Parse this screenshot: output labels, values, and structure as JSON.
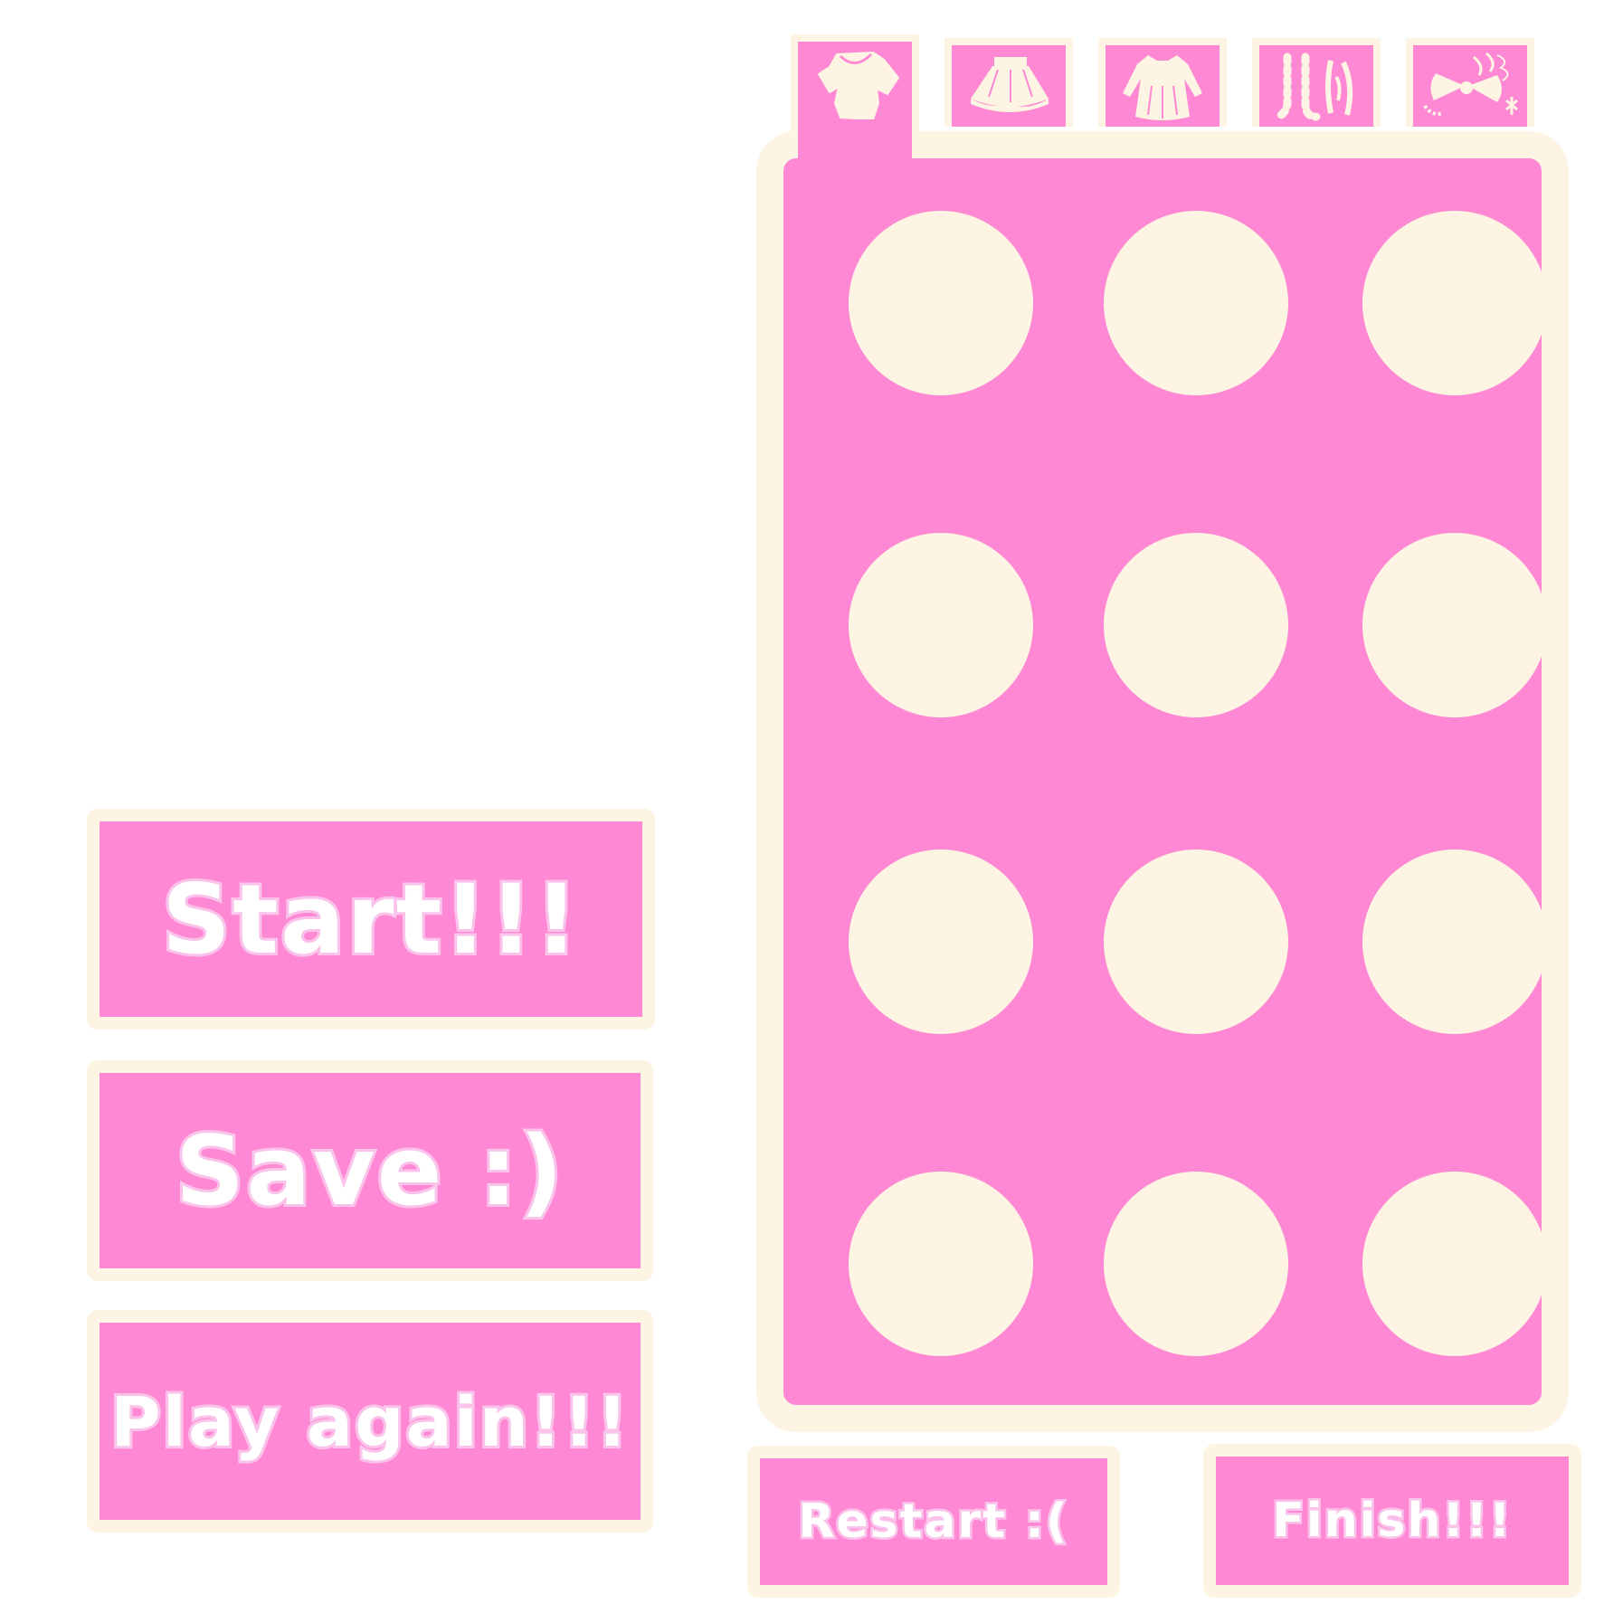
{
  "menu": {
    "start_label": "Start!!!",
    "save_label": "Save :)",
    "play_again_label": "Play again!!!"
  },
  "wardrobe": {
    "tabs": [
      {
        "icon": "shirt-icon",
        "active": true
      },
      {
        "icon": "skirt-icon",
        "active": false
      },
      {
        "icon": "dress-icon",
        "active": false
      },
      {
        "icon": "socks-icon",
        "active": false
      },
      {
        "icon": "accessories-icon",
        "active": false
      }
    ],
    "slot_rows": 4,
    "slot_columns": 3
  },
  "actions": {
    "restart_label": "Restart :(",
    "finish_label": "Finish!!!"
  },
  "colors": {
    "primary_pink": "#fe88d3",
    "cream": "#fdf4e3",
    "text_white": "#ffffff",
    "text_outline_pink": "#fbc6ec"
  }
}
